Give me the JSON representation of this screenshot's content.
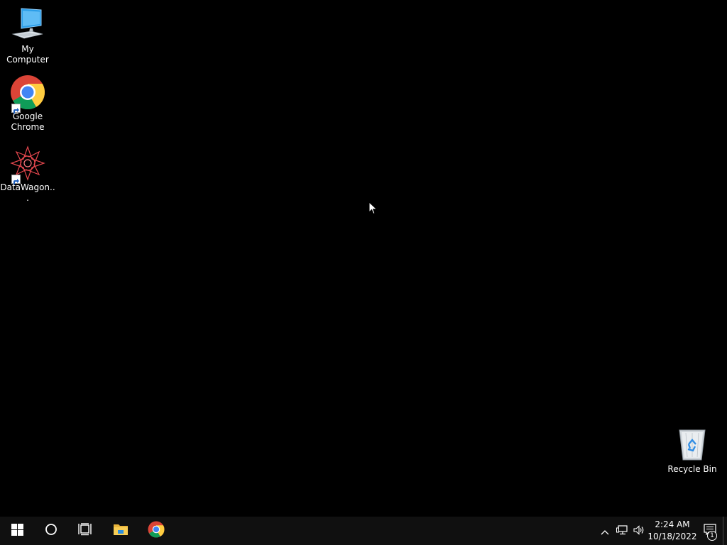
{
  "desktop": {
    "background_color": "#000000",
    "icons": [
      {
        "label": "My Computer",
        "icon": "computer-icon"
      },
      {
        "label": "Google\nChrome",
        "icon": "chrome-icon"
      },
      {
        "label": "DataWagon...",
        "icon": "datawagon-icon"
      },
      {
        "label": "Recycle Bin",
        "icon": "recycle-bin-icon"
      }
    ]
  },
  "taskbar": {
    "buttons": [
      {
        "icon": "windows-start-icon"
      },
      {
        "icon": "cortana-search-icon"
      },
      {
        "icon": "task-view-icon"
      },
      {
        "icon": "file-explorer-icon"
      },
      {
        "icon": "chrome-icon"
      }
    ],
    "tray": {
      "icons": [
        "chevron-up-icon",
        "network-icon",
        "volume-icon"
      ],
      "time": "2:24 AM",
      "date": "10/18/2022",
      "notification_count": "1"
    }
  }
}
